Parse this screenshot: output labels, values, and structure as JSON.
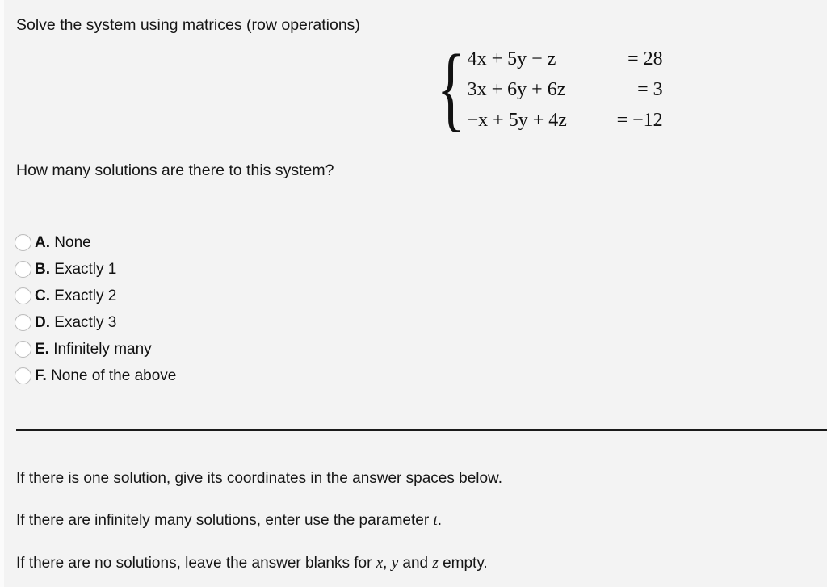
{
  "page": {
    "background_color": "#f3f3f3",
    "text_color": "#161616",
    "divider_color": "#1a1a1a"
  },
  "prompt": {
    "title": "Solve the system using matrices (row operations)"
  },
  "system": {
    "brace": "{",
    "equations": [
      {
        "lhs": "4x + 5y − z",
        "rhs": "= 28"
      },
      {
        "lhs": "3x + 6y + 6z",
        "rhs": "= 3"
      },
      {
        "lhs": "−x + 5y + 4z",
        "rhs": "= −12"
      }
    ],
    "coefficients": [
      [
        4,
        5,
        -1,
        28
      ],
      [
        3,
        6,
        6,
        3
      ],
      [
        -1,
        5,
        4,
        -12
      ]
    ],
    "variables": [
      "x",
      "y",
      "z"
    ]
  },
  "question": {
    "text": "How many solutions are there to this system?"
  },
  "choices": [
    {
      "letter": "A.",
      "text": "None",
      "selected": false
    },
    {
      "letter": "B.",
      "text": "Exactly 1",
      "selected": false
    },
    {
      "letter": "C.",
      "text": "Exactly 2",
      "selected": false
    },
    {
      "letter": "D.",
      "text": "Exactly 3",
      "selected": false
    },
    {
      "letter": "E.",
      "text": "Infinitely many",
      "selected": false
    },
    {
      "letter": "F.",
      "text": "None of the above",
      "selected": false
    }
  ],
  "notes": {
    "note_1": "If there is one solution, give its coordinates in the answer spaces below.",
    "note_2_pre": "If there are infinitely many solutions, enter use the parameter ",
    "note_2_var": "t",
    "note_2_post": ".",
    "note_3_pre": "If there are no solutions, leave the answer blanks for ",
    "note_3_var_x": "x",
    "note_3_sep_1": ", ",
    "note_3_var_y": "y",
    "note_3_sep_2": " and ",
    "note_3_var_z": "z",
    "note_3_post": " empty."
  }
}
